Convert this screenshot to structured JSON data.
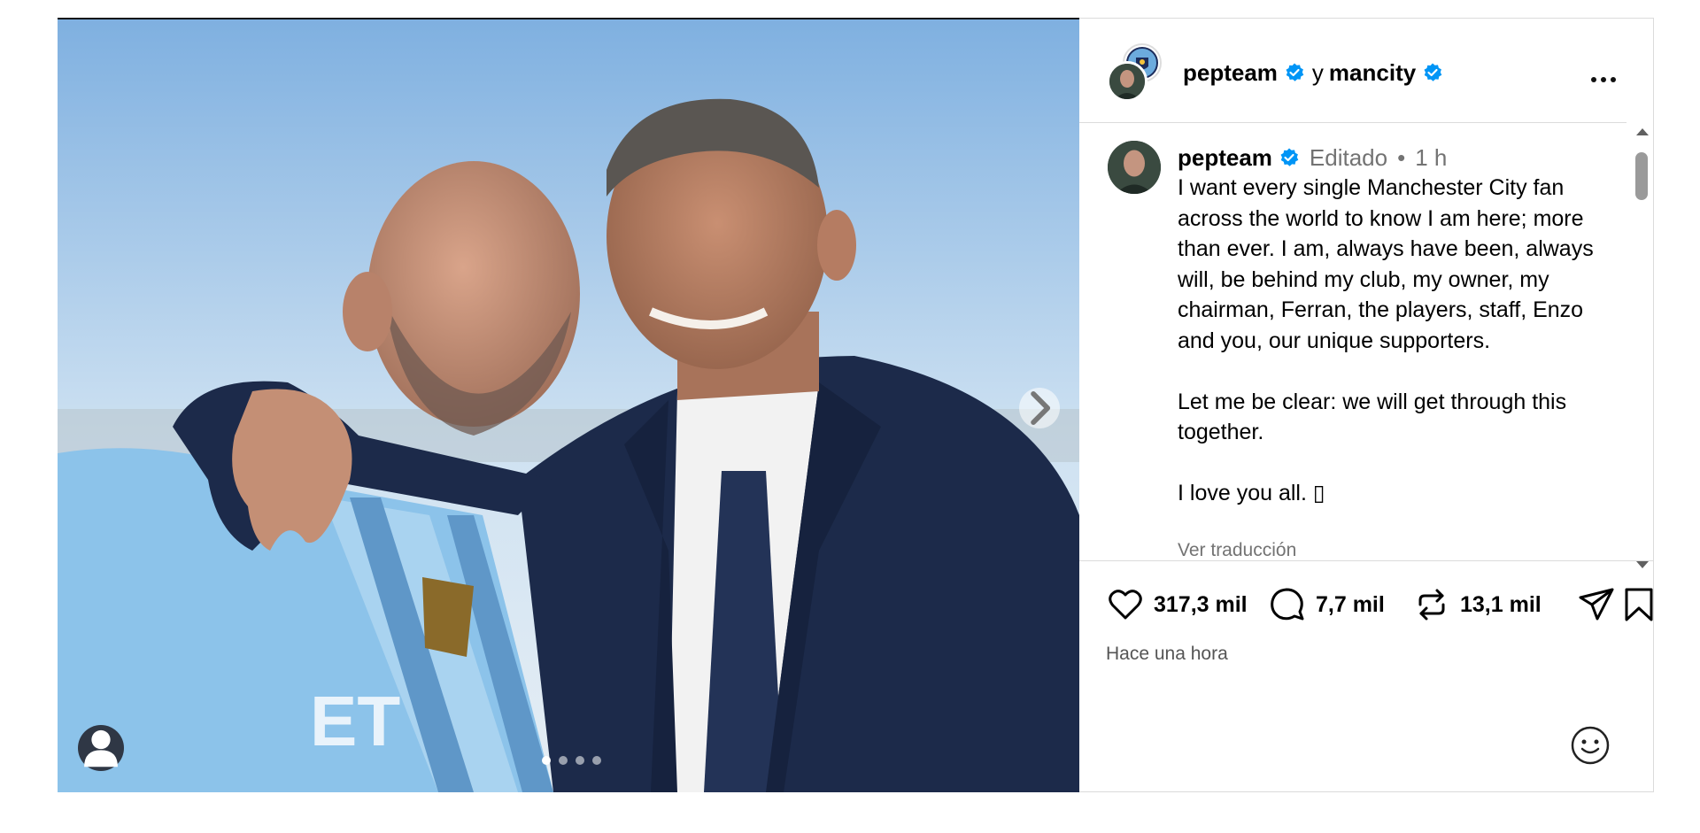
{
  "post": {
    "header": {
      "author": "pepteam",
      "conjunction": "y",
      "collaborator": "mancity"
    },
    "caption": {
      "author": "pepteam",
      "edited_label": "Editado",
      "separator": "•",
      "time": "1 h",
      "text": "I want every single Manchester City fan across the world to know I am here; more than ever. I am, always have been, always will, be behind my club, my owner, my chairman, Ferran, the players, staff, Enzo and you, our unique supporters.\n\nLet me be clear: we will get through this together.\n\nI love you all. ▯",
      "translate_label": "Ver traducción"
    },
    "stats": {
      "likes": "317,3 mil",
      "comments": "7,7 mil",
      "reposts": "13,1 mil"
    },
    "posted_label": "Hace una hora",
    "carousel": {
      "total_slides": 4,
      "active_slide": 1
    }
  },
  "colors": {
    "verified": "#0095f6",
    "muted_text": "#737373",
    "divider": "#dbdbdb",
    "sky": "#9cc3e6",
    "city_blue": "#7fb8e6",
    "suit_navy": "#1c2a4a"
  },
  "icons": {
    "like": "heart-icon",
    "comment": "comment-bubble-icon",
    "repost": "repost-icon",
    "share": "paper-plane-icon",
    "save": "bookmark-icon",
    "more": "more-options-icon",
    "next": "chevron-right-icon",
    "tag": "user-tag-icon",
    "emoji": "emoji-icon"
  }
}
